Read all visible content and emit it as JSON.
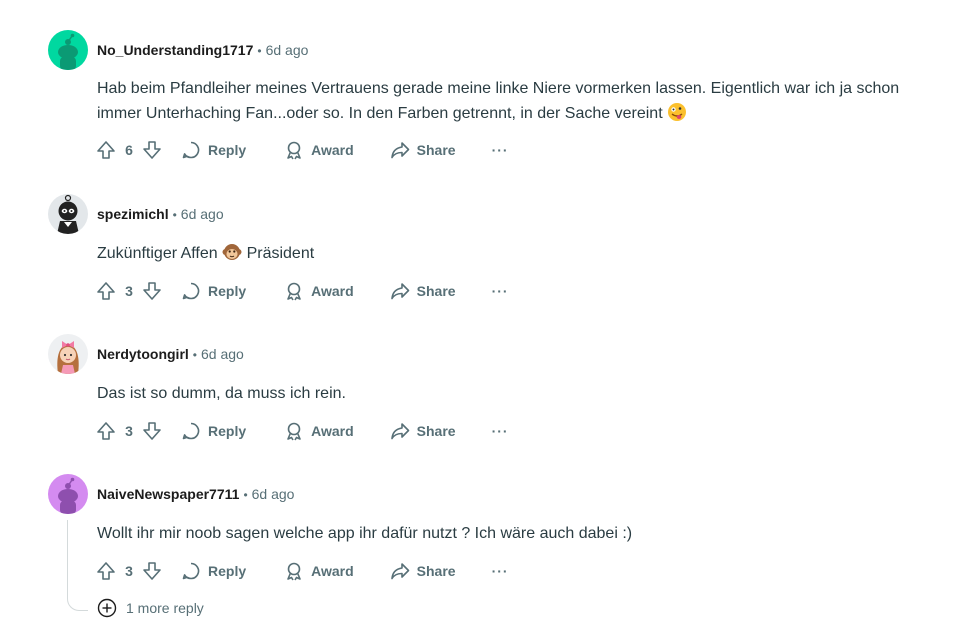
{
  "comments": [
    {
      "username": "No_Understanding1717",
      "time": "6d ago",
      "text": "Hab beim Pfandleiher meines Vertrauens gerade meine linke Niere vormerken lassen. Eigentlich war ich ja schon immer Unterhaching Fan...oder so. In den Farben getrennt, in der Sache vereint",
      "emoji": "zany-face",
      "votes": "6",
      "avatar": "snoo-green"
    },
    {
      "username": "spezimichl",
      "time": "6d ago",
      "text_before": "Zukünftiger Affen",
      "text_after": "Präsident",
      "emoji": "monkey-face",
      "votes": "3",
      "avatar": "dark-character"
    },
    {
      "username": "Nerdytoongirl",
      "time": "6d ago",
      "text": "Das ist so dumm, da muss ich rein.",
      "votes": "3",
      "avatar": "pink-bow-character"
    },
    {
      "username": "NaiveNewspaper7711",
      "time": "6d ago",
      "text": "Wollt ihr mir noob sagen welche app ihr dafür nutzt ? Ich wäre auch dabei :)",
      "votes": "3",
      "avatar": "snoo-purple"
    }
  ],
  "actions": {
    "reply": "Reply",
    "award": "Award",
    "share": "Share",
    "more": "···"
  },
  "separator": "•",
  "more_replies": "1 more reply",
  "colors": {
    "avatar_green": "#00d8a0",
    "avatar_purple": "#d48bf0",
    "meta": "#576f76",
    "body": "#2a3c42"
  }
}
